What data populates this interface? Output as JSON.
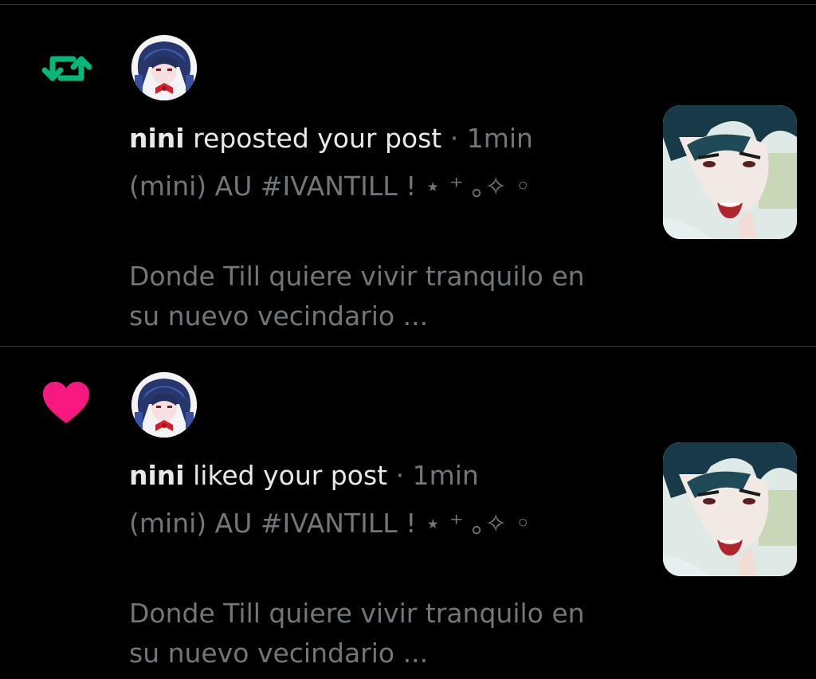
{
  "notifications": [
    {
      "type": "repost",
      "icon": "repost-icon",
      "icon_color": "#00ba7c",
      "user": "nini",
      "action": "reposted your post",
      "separator": "·",
      "time": "1min",
      "post_title": "(mini) AU #IVANTILL ! ⋆ ⁺ ｡✧ ◦",
      "post_body_line1": "Donde Till quiere vivir tranquilo en",
      "post_body_line2": "su nuevo vecindario ..."
    },
    {
      "type": "like",
      "icon": "heart-icon",
      "icon_color": "#f91880",
      "user": "nini",
      "action": "liked your post",
      "separator": "·",
      "time": "1min",
      "post_title": "(mini) AU #IVANTILL ! ⋆ ⁺ ｡✧ ◦",
      "post_body_line1": "Donde Till quiere vivir tranquilo en",
      "post_body_line2": "su nuevo vecindario ..."
    }
  ]
}
